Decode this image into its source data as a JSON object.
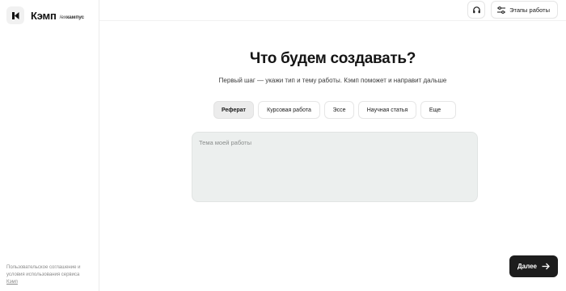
{
  "brand": {
    "name": "Кэмп",
    "sub_prefix": "/ex",
    "sub_name": "кампус"
  },
  "sidebar_footer": {
    "text": "Пользовательское соглашение и условия использования сервиса",
    "link": "Кэмп"
  },
  "top_actions": {
    "stages_label": "Этапы работы"
  },
  "main": {
    "title": "Что будем создавать?",
    "subtitle": "Первый шаг — укажи тип и тему работы. Кэмп поможет и направит дальше",
    "chips": [
      {
        "label": "Реферат",
        "active": true
      },
      {
        "label": "Курсовая работа",
        "active": false
      },
      {
        "label": "Эссе",
        "active": false
      },
      {
        "label": "Научная статья",
        "active": false
      },
      {
        "label": "Еще",
        "active": false
      }
    ],
    "topic_placeholder": "Тема моей работы"
  },
  "next_label": "Далее",
  "colors": {
    "accent_dark": "#1d1d1d",
    "chip_active_bg": "#ececec",
    "textarea_bg": "#ecefee"
  }
}
